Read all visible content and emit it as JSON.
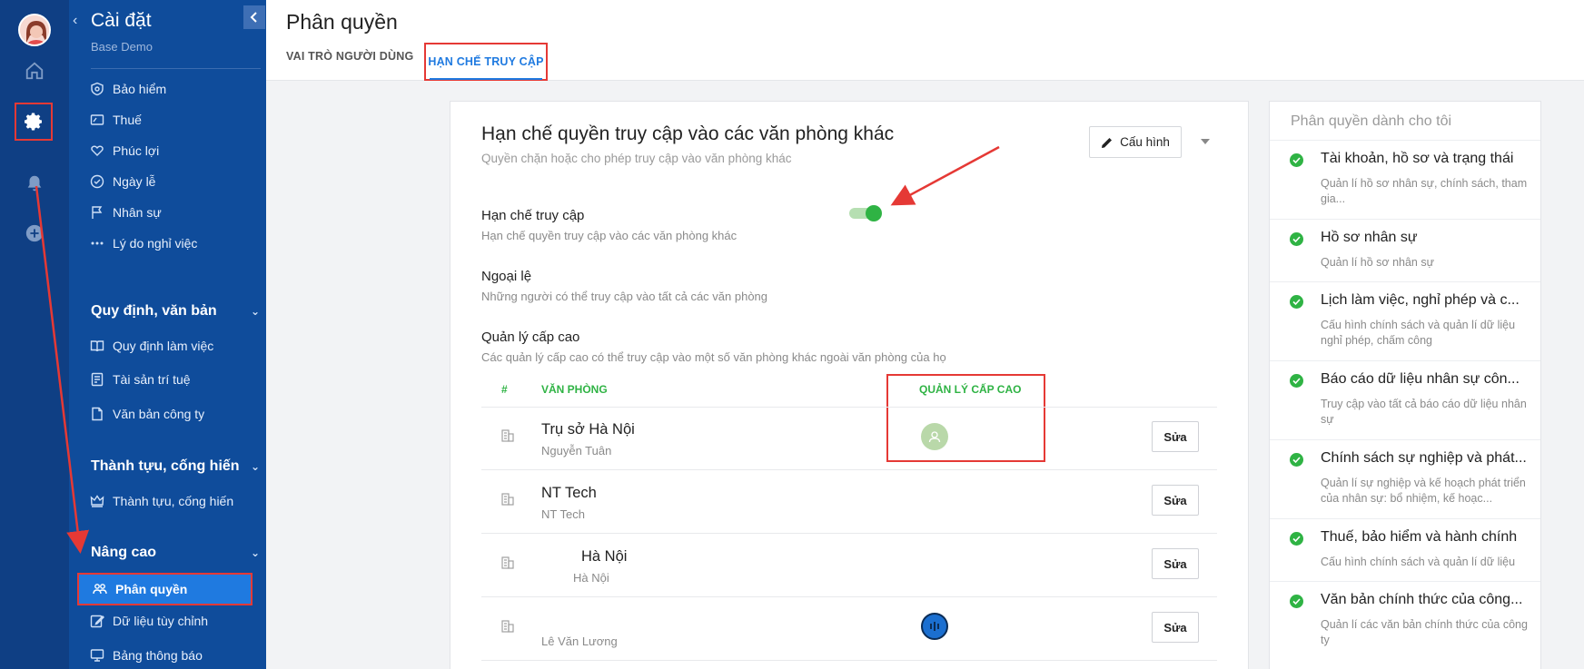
{
  "sidebar": {
    "title": "Cài đặt",
    "subtitle": "Base Demo",
    "items_top": [
      {
        "label": "Bảo hiểm",
        "icon": "shield-icon"
      },
      {
        "label": "Thuế",
        "icon": "tax-icon"
      },
      {
        "label": "Phúc lợi",
        "icon": "heart-hand-icon"
      },
      {
        "label": "Ngày lễ",
        "icon": "check-circle-icon"
      },
      {
        "label": "Nhân sự",
        "icon": "flag-icon"
      },
      {
        "label": "Lý do nghỉ việc",
        "icon": "dots-icon"
      }
    ],
    "section_rules": {
      "title": "Quy định, văn bản",
      "items": [
        {
          "label": "Quy định làm việc",
          "icon": "book-icon"
        },
        {
          "label": "Tài sản trí tuệ",
          "icon": "document-icon"
        },
        {
          "label": "Văn bản công ty",
          "icon": "file-icon"
        }
      ]
    },
    "section_achievements": {
      "title": "Thành tựu, cống hiến",
      "items": [
        {
          "label": "Thành tựu, cống hiến",
          "icon": "crown-icon"
        }
      ]
    },
    "section_advanced": {
      "title": "Nâng cao",
      "items": [
        {
          "label": "Phân quyền",
          "icon": "users-icon"
        },
        {
          "label": "Dữ liệu tùy chỉnh",
          "icon": "edit-icon"
        },
        {
          "label": "Bảng thông báo",
          "icon": "monitor-icon"
        }
      ]
    }
  },
  "header": {
    "title": "Phân quyền",
    "tabs": [
      {
        "label": "VAI TRÒ NGƯỜI DÙNG"
      },
      {
        "label": "HẠN CHẾ TRUY CẬP"
      }
    ]
  },
  "card": {
    "title": "Hạn chế quyền truy cập vào các văn phòng khác",
    "subtitle": "Quyền chặn hoặc cho phép truy cập vào văn phòng khác",
    "config_label": "Cấu hình",
    "restrict": {
      "label": "Hạn chế truy cập",
      "desc": "Hạn chế quyền truy cập vào các văn phòng khác",
      "enabled": true
    },
    "exception": {
      "label": "Ngoại lệ",
      "desc": "Những người có thể truy cập vào tất cả các văn phòng"
    },
    "senior": {
      "label": "Quản lý cấp cao",
      "desc": "Các quản lý cấp cao có thể truy cập vào một số văn phòng khác ngoài văn phòng của họ"
    },
    "table": {
      "col_index": "#",
      "col_office": "VĂN PHÒNG",
      "col_manager": "QUẢN LÝ CẤP CAO",
      "edit_label": "Sửa",
      "rows": [
        {
          "name": "Trụ sở Hà Nội",
          "sub": "Nguyễn Tuân"
        },
        {
          "name": "NT Tech",
          "sub": "NT Tech"
        },
        {
          "name": "Hà Nội",
          "sub": "Hà Nội"
        },
        {
          "name": "",
          "sub": "Lê Văn Lương"
        }
      ]
    }
  },
  "right_panel": {
    "title": "Phân quyền dành cho tôi",
    "items": [
      {
        "name": "Tài khoản, hồ sơ và trạng thái",
        "desc": "Quản lí hồ sơ nhân sự, chính sách, tham gia..."
      },
      {
        "name": "Hồ sơ nhân sự",
        "desc": "Quản lí hồ sơ nhân sự"
      },
      {
        "name": "Lịch làm việc, nghỉ phép và c...",
        "desc": "Cấu hình chính sách và quản lí dữ liệu nghỉ phép, chấm công"
      },
      {
        "name": "Báo cáo dữ liệu nhân sự côn...",
        "desc": "Truy cập vào tất cả báo cáo dữ liệu nhân sự"
      },
      {
        "name": "Chính sách sự nghiệp và phát...",
        "desc": "Quản lí sự nghiệp và kế hoạch phát triển của nhân sự: bổ nhiệm, kế hoạc..."
      },
      {
        "name": "Thuế, bảo hiểm và hành chính",
        "desc": "Cấu hình chính sách và quản lí dữ liệu"
      },
      {
        "name": "Văn bản chính thức của công...",
        "desc": "Quản lí các văn bản chính thức của công ty"
      }
    ]
  },
  "colors": {
    "accent": "#1f7ae0",
    "success": "#2fb344",
    "annotation": "#e53935",
    "sidebar": "#0f4c9b",
    "rail": "#0f3f84"
  }
}
